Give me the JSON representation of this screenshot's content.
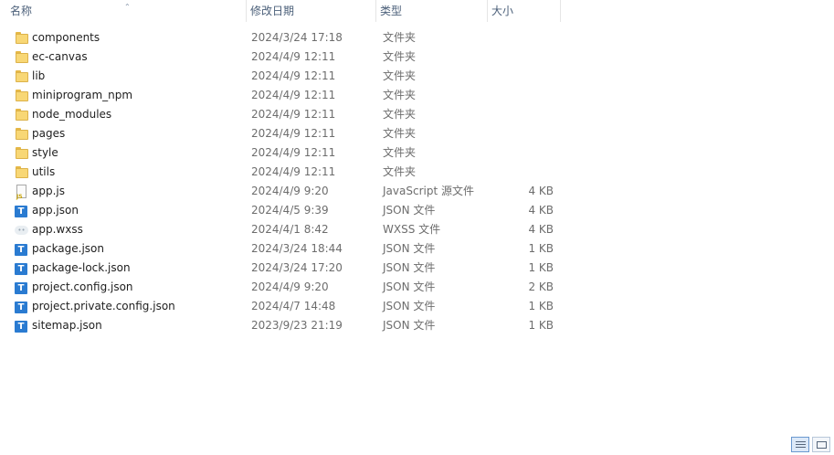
{
  "columns": {
    "name": "名称",
    "date": "修改日期",
    "type": "类型",
    "size": "大小"
  },
  "files": [
    {
      "name": "components",
      "date": "2024/3/24 17:18",
      "type": "文件夹",
      "size": "",
      "icon": "folder-icon"
    },
    {
      "name": "ec-canvas",
      "date": "2024/4/9 12:11",
      "type": "文件夹",
      "size": "",
      "icon": "folder-icon"
    },
    {
      "name": "lib",
      "date": "2024/4/9 12:11",
      "type": "文件夹",
      "size": "",
      "icon": "folder-icon"
    },
    {
      "name": "miniprogram_npm",
      "date": "2024/4/9 12:11",
      "type": "文件夹",
      "size": "",
      "icon": "folder-icon"
    },
    {
      "name": "node_modules",
      "date": "2024/4/9 12:11",
      "type": "文件夹",
      "size": "",
      "icon": "folder-icon"
    },
    {
      "name": "pages",
      "date": "2024/4/9 12:11",
      "type": "文件夹",
      "size": "",
      "icon": "folder-icon"
    },
    {
      "name": "style",
      "date": "2024/4/9 12:11",
      "type": "文件夹",
      "size": "",
      "icon": "folder-icon"
    },
    {
      "name": "utils",
      "date": "2024/4/9 12:11",
      "type": "文件夹",
      "size": "",
      "icon": "folder-icon"
    },
    {
      "name": "app.js",
      "date": "2024/4/9 9:20",
      "type": "JavaScript 源文件",
      "size": "4 KB",
      "icon": "js-file-icon"
    },
    {
      "name": "app.json",
      "date": "2024/4/5 9:39",
      "type": "JSON 文件",
      "size": "4 KB",
      "icon": "json-file-icon"
    },
    {
      "name": "app.wxss",
      "date": "2024/4/1 8:42",
      "type": "WXSS 文件",
      "size": "4 KB",
      "icon": "wxss-file-icon"
    },
    {
      "name": "package.json",
      "date": "2024/3/24 18:44",
      "type": "JSON 文件",
      "size": "1 KB",
      "icon": "json-file-icon"
    },
    {
      "name": "package-lock.json",
      "date": "2024/3/24 17:20",
      "type": "JSON 文件",
      "size": "1 KB",
      "icon": "json-file-icon"
    },
    {
      "name": "project.config.json",
      "date": "2024/4/9 9:20",
      "type": "JSON 文件",
      "size": "2 KB",
      "icon": "json-file-icon"
    },
    {
      "name": "project.private.config.json",
      "date": "2024/4/7 14:48",
      "type": "JSON 文件",
      "size": "1 KB",
      "icon": "json-file-icon"
    },
    {
      "name": "sitemap.json",
      "date": "2023/9/23 21:19",
      "type": "JSON 文件",
      "size": "1 KB",
      "icon": "json-file-icon"
    }
  ],
  "colors": {
    "header_text": "#4c607a",
    "folder": "#f8d775",
    "json_icon": "#2a7bd1"
  }
}
